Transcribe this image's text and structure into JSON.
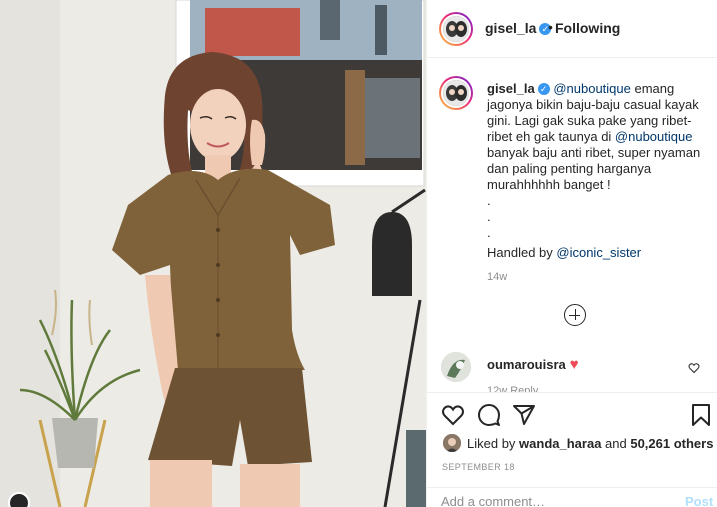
{
  "post_header": {
    "username": "gisel_la",
    "verified_icon": "verified-badge-icon",
    "separator": "•",
    "follow_status": "Following"
  },
  "caption": {
    "username": "gisel_la",
    "mention1": "@nuboutique",
    "text1": " emang jagonya bikin baju-baju casual kayak gini. Lagi gak suka pake yang ribet-ribet eh gak taunya di ",
    "mention2": "@nuboutique",
    "text2": " banyak baju anti ribet, super nyaman dan paling penting harganya murahhhhhh banget !",
    "dots": [
      ".",
      ".",
      "."
    ],
    "handled_prefix": "Handled by ",
    "handled_mention": "@iconic_sister",
    "time_ago": "14w"
  },
  "comment": {
    "username": "oumarouisra",
    "emoji": "♥",
    "meta": "12w  Reply"
  },
  "actions": {
    "icons": [
      "heart-icon",
      "comment-icon",
      "share-icon",
      "bookmark-icon"
    ]
  },
  "likes": {
    "prefix": "Liked by ",
    "user": "wanda_haraa",
    "middle": " and ",
    "count": "50,261 others"
  },
  "date": "SEPTEMBER 18",
  "add_comment": {
    "placeholder": "Add a comment…",
    "post_label": "Post"
  },
  "colors": {
    "accent": "#3897f0",
    "mention": "#00376b",
    "secondary_text": "#8e8e8e",
    "like_red": "#ed4956"
  }
}
